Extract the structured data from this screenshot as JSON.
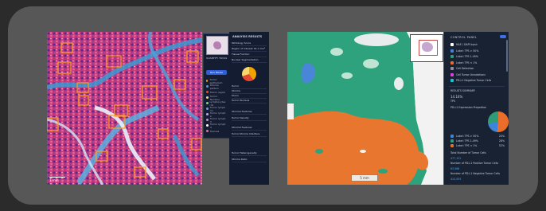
{
  "screenshot_left": {
    "scalebar": "1 mm",
    "tools": {
      "title": "QUANTIFY TOOLS",
      "action_button": "Run Model",
      "rows": [
        {
          "label": "Tumor epithelium",
          "color": "#f2a200"
        },
        {
          "label": "Stroma pattern",
          "color": "#3ba8d8"
        },
        {
          "label": "Mucin region",
          "color": "#e34832"
        },
        {
          "label": "Tumor Nucleus",
          "color": "#f8d66a"
        },
        {
          "label": "Lymphocytes roll",
          "color": "#7fd07f"
        },
        {
          "label": "Tumor lymph ml",
          "color": "#5aa0f0"
        },
        {
          "label": "Tumor lymph 2",
          "color": "#c7a3f0"
        },
        {
          "label": "Tumor lymph 3",
          "color": "#e07ad0"
        },
        {
          "label": "Tumor lymph 4",
          "color": "#ffffff"
        },
        {
          "label": "Mucosa",
          "color": "#ff6688"
        }
      ]
    },
    "results": {
      "title": "ANALYSIS RESULTS",
      "rows": [
        "Pathology Score",
        "Region of Interest    32.1 mm²",
        "Tissue Fraction",
        "Nuclear Segmentation",
        "Tumor",
        "Stroma",
        "Mucin",
        "Tumor Nucleus",
        "Stromal Features",
        "Tumor Density",
        "Stromal Features",
        "Tumor-Stroma Interface",
        "Tumor Heterogeneity",
        "Stroma Ratio"
      ]
    }
  },
  "screenshot_right": {
    "scalebar": "5 mm",
    "panel": {
      "title": "CONTROL PANEL",
      "legend": [
        {
          "label": "H&E / DAPI Input",
          "color": "#ffffff"
        },
        {
          "label": "Label: TPS > 50%",
          "color": "#3e84d8"
        },
        {
          "label": "Label: TPS 1-49%",
          "color": "#2f9c78"
        },
        {
          "label": "Label: TPS < 1%",
          "color": "#ea6d2a"
        },
        {
          "label": "Cell Detection",
          "color": "#8a8f9a"
        },
        {
          "label": "Cell Tumor Annotations",
          "color": "#e040e0"
        },
        {
          "label": "PD-L1 Negative Tumor Cells",
          "color": "#17c5d4"
        }
      ],
      "section": "RESULTS SUMMARY",
      "score_label": "14.16%",
      "score_sub": "TPS",
      "proportion_title": "PD-L1 Expression Proportion",
      "pie_legend": [
        {
          "label": "Label: TPS > 50%",
          "color": "#3e84d8",
          "value": "20%"
        },
        {
          "label": "Label: TPS 1-49%",
          "color": "#2f9c78",
          "value": "28%"
        },
        {
          "label": "Label: TPS < 1%",
          "color": "#ea6d2a",
          "value": "52%"
        }
      ],
      "stats": [
        "Total Number of Tumor Cells",
        "477,121",
        "Number of PD-L1 Positive Tumor Cells",
        "63,568",
        "Number of PD-L1 Negative Tumor Cells",
        "413,553"
      ]
    }
  }
}
